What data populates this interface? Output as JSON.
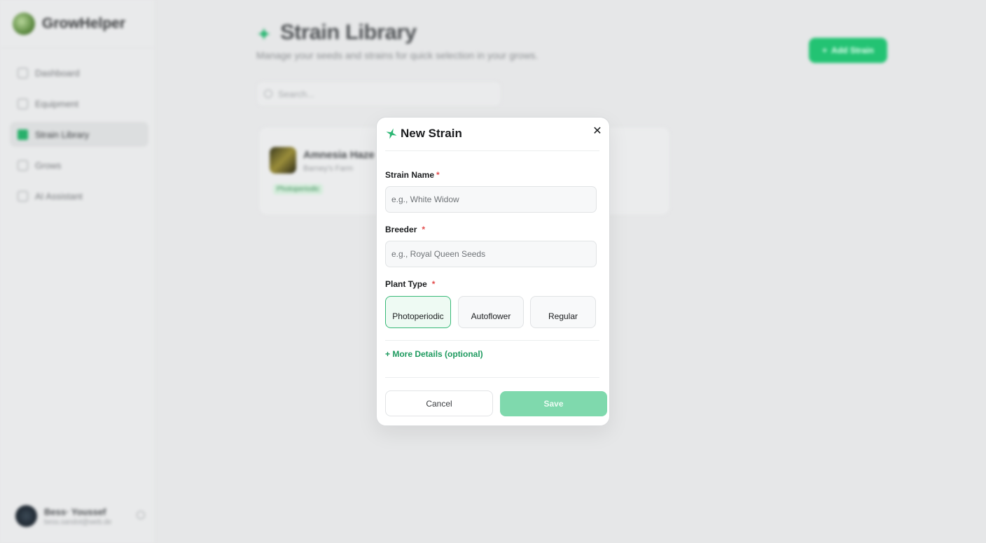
{
  "colors": {
    "accent": "#23c373",
    "accent_text": "#1e9a5f",
    "save_disabled": "#7fd9ad",
    "required": "#e24b4b"
  },
  "sidebar": {
    "brand": "GrowHelper",
    "items": [
      {
        "label": "Dashboard",
        "icon": "grid-icon"
      },
      {
        "label": "Equipment",
        "icon": "box-icon"
      },
      {
        "label": "Strain Library",
        "icon": "leaf-icon",
        "active": true
      },
      {
        "label": "Grows",
        "icon": "sprout-icon"
      },
      {
        "label": "AI Assistant",
        "icon": "chat-icon"
      }
    ],
    "user": {
      "name": "Bess· Youssef",
      "email": "bess.sandot@web.de"
    }
  },
  "main": {
    "title": "Strain Library",
    "subtitle": "Manage your seeds and strains for quick selection in your grows.",
    "add_button": "Add Strain",
    "search_placeholder": "Search...",
    "cards": [
      {
        "name": "Amnesia Haze",
        "breeder": "Barney's Farm",
        "type": "Photoperiodic"
      }
    ]
  },
  "modal": {
    "title": "New Strain",
    "strain_name": {
      "label": "Strain Name",
      "required": "*",
      "value": "",
      "placeholder": "e.g., White Widow"
    },
    "breeder": {
      "label": "Breeder",
      "required": "*",
      "value": "",
      "placeholder": "e.g., Royal Queen Seeds"
    },
    "plant_type": {
      "label": "Plant Type",
      "required": "*",
      "options": [
        "Photoperiodic",
        "Autoflower",
        "Regular"
      ],
      "selected": "Photoperiodic"
    },
    "more_details": "+ More Details (optional)",
    "cancel": "Cancel",
    "save": "Save"
  }
}
